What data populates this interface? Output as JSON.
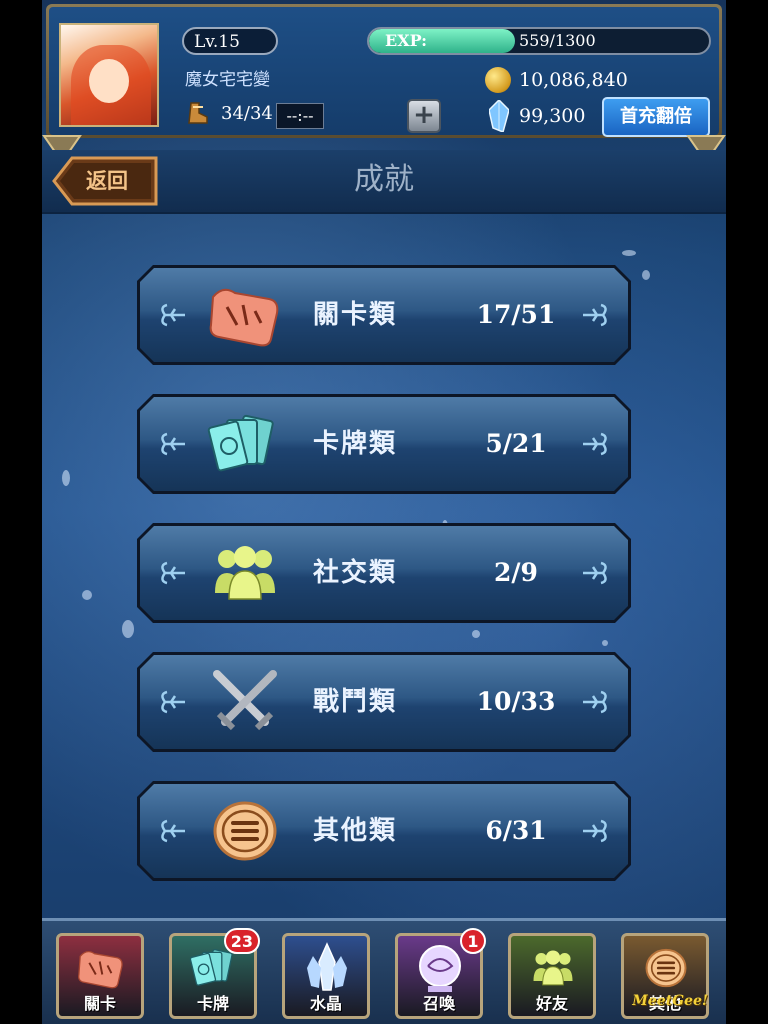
{
  "header": {
    "level": "Lv.15",
    "exp_label": "EXP:",
    "exp_text": "559/1300",
    "exp_fraction": 0.43,
    "player_name": "魔女宅宅變",
    "stamina": "34/34",
    "timer": "--:--",
    "gold": "10,086,840",
    "crystals": "99,300",
    "topup_label": "首充翻倍"
  },
  "titlebar": {
    "back_label": "返回",
    "title": "成就"
  },
  "categories": [
    {
      "name": "關卡類",
      "count": "17/51",
      "icon": "scroll-map-icon"
    },
    {
      "name": "卡牌類",
      "count": "5/21",
      "icon": "cards-icon"
    },
    {
      "name": "社交類",
      "count": "2/9",
      "icon": "friends-icon"
    },
    {
      "name": "戰鬥類",
      "count": "10/33",
      "icon": "crossed-swords-icon"
    },
    {
      "name": "其他類",
      "count": "6/31",
      "icon": "menu-circle-icon"
    }
  ],
  "bottom_nav": [
    {
      "label": "關卡",
      "icon": "scroll-map-icon",
      "color": "#8e2f40"
    },
    {
      "label": "卡牌",
      "icon": "cards-icon",
      "color": "#2f6f64",
      "badge": "23"
    },
    {
      "label": "水晶",
      "icon": "crystal-icon",
      "color": "#2e4f8f"
    },
    {
      "label": "召喚",
      "icon": "summon-orb-icon",
      "color": "#6a3a8a",
      "badge": "1"
    },
    {
      "label": "好友",
      "icon": "friends-icon",
      "color": "#4c6a2c"
    },
    {
      "label": "其他",
      "icon": "menu-circle-icon",
      "color": "#7a5a30"
    }
  ],
  "watermark": "MeetGee!"
}
